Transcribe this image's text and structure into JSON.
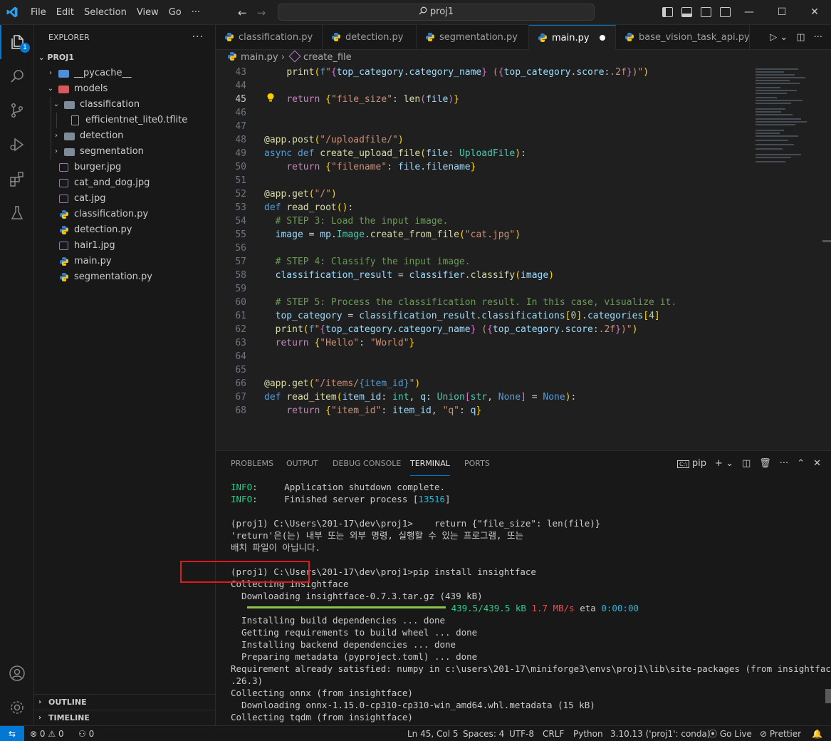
{
  "titlebar": {
    "menu": [
      "File",
      "Edit",
      "Selection",
      "View",
      "Go",
      "···"
    ],
    "search": "proj1"
  },
  "explorer": {
    "title": "EXPLORER",
    "root": "PROJ1",
    "items": [
      {
        "label": "__pycache__",
        "type": "folder",
        "color": "#4f8fd6"
      },
      {
        "label": "models",
        "type": "folder-open",
        "color": "#d65a5a"
      },
      {
        "label": "classification",
        "type": "folder-open"
      },
      {
        "label": "efficientnet_lite0.tflite",
        "type": "file"
      },
      {
        "label": "detection",
        "type": "folder"
      },
      {
        "label": "segmentation",
        "type": "folder"
      },
      {
        "label": "burger.jpg",
        "type": "image"
      },
      {
        "label": "cat_and_dog.jpg",
        "type": "image"
      },
      {
        "label": "cat.jpg",
        "type": "image"
      },
      {
        "label": "classification.py",
        "type": "python"
      },
      {
        "label": "detection.py",
        "type": "python"
      },
      {
        "label": "hair1.jpg",
        "type": "image"
      },
      {
        "label": "main.py",
        "type": "python"
      },
      {
        "label": "segmentation.py",
        "type": "python"
      }
    ],
    "outline": "OUTLINE",
    "timeline": "TIMELINE",
    "badge": "1"
  },
  "tabs": [
    {
      "label": "classification.py",
      "active": false
    },
    {
      "label": "detection.py",
      "active": false
    },
    {
      "label": "segmentation.py",
      "active": false
    },
    {
      "label": "main.py",
      "active": true,
      "dirty": true
    },
    {
      "label": "base_vision_task_api.py",
      "active": false
    }
  ],
  "breadcrumb": {
    "file": "main.py",
    "symbol": "create_file"
  },
  "editor": {
    "current_line": 45,
    "line_numbers": [
      "43",
      "44",
      "45",
      "46",
      "47",
      "48",
      "49",
      "50",
      "51",
      "52",
      "53",
      "54",
      "55",
      "56",
      "57",
      "58",
      "59",
      "60",
      "61",
      "62",
      "63",
      "64",
      "65",
      "66",
      "67",
      "68"
    ]
  },
  "panel": {
    "tabs": [
      "PROBLEMS",
      "OUTPUT",
      "DEBUG CONSOLE",
      "TERMINAL",
      "PORTS"
    ],
    "active_tab": "TERMINAL",
    "terminal_name": "pip",
    "terminal_lines": [
      "INFO:     Application shutdown complete.",
      "INFO:     Finished server process [13516]",
      "",
      "(proj1) C:\\Users\\201-17\\dev\\proj1>    return {\"file_size\": len(file)}",
      "'return'은(는) 내부 또는 외부 명령, 실행할 수 있는 프로그램, 또는",
      "배치 파일이 아닙니다.",
      "",
      "(proj1) C:\\Users\\201-17\\dev\\proj1>pip install insightface",
      "Collecting insightface",
      "  Downloading insightface-0.7.3.tar.gz (439 kB)",
      "",
      "  Installing build dependencies ... done",
      "  Getting requirements to build wheel ... done",
      "  Installing backend dependencies ... done",
      "  Preparing metadata (pyproject.toml) ... done",
      "Requirement already satisfied: numpy in c:\\users\\201-17\\miniforge3\\envs\\proj1\\lib\\site-packages (from insightface) (1",
      ".26.3)",
      "Collecting onnx (from insightface)",
      "  Downloading onnx-1.15.0-cp310-cp310-win_amd64.whl.metadata (15 kB)",
      "Collecting tqdm (from insightface)"
    ],
    "progress": {
      "done": "439.5/439.5 kB",
      "speed": "1.7 MB/s",
      "eta_label": "eta",
      "eta": "0:00:00",
      "fraction": 1.0
    }
  },
  "status": {
    "errors": "0",
    "warnings": "0",
    "ports": "0",
    "position": "Ln 45, Col 5",
    "spaces": "Spaces: 4",
    "encoding": "UTF-8",
    "eol": "CRLF",
    "language": "Python",
    "interpreter": "3.10.13 ('proj1': conda)",
    "golive": "Go Live",
    "prettier": "Prettier"
  },
  "colors": {
    "accent": "#0078d4",
    "highlight_box": "#e01a1a",
    "progress": "#8bc34a"
  }
}
